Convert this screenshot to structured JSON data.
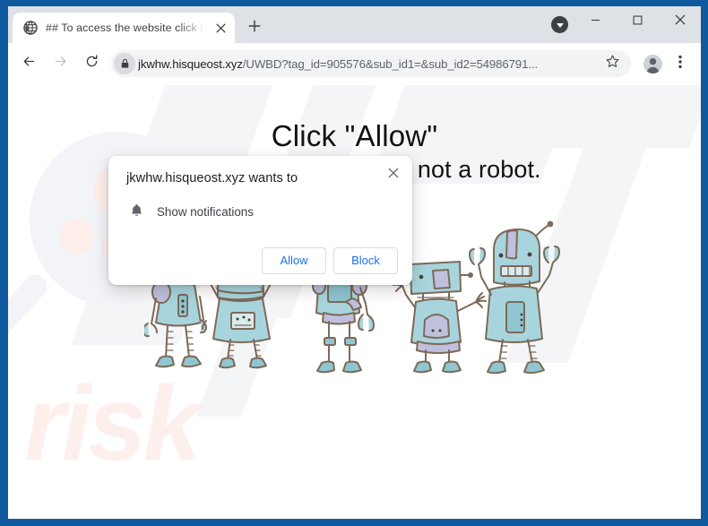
{
  "browser": {
    "tab": {
      "favicon": "globe-icon",
      "title": "## To access the website click th",
      "close_icon": "close-icon"
    },
    "new_tab_icon": "plus-icon",
    "tab_list_dropdown_icon": "chevron-down-icon",
    "window_controls": {
      "minimize": "minimize-icon",
      "maximize": "maximize-icon",
      "close": "close-icon"
    },
    "toolbar": {
      "back_icon": "back-arrow-icon",
      "forward_icon": "forward-arrow-icon",
      "reload_icon": "reload-icon",
      "lock_icon": "lock-icon",
      "url_host": "jkwhw.hisqueost.xyz",
      "url_path": "/UWBD?tag_id=905576&sub_id1=&sub_id2=54986791...",
      "url_full": "jkwhw.hisqueost.xyz/UWBD?tag_id=905576&sub_id1=&sub_id2=54986791...",
      "bookmark_icon": "star-icon",
      "profile_icon": "person-avatar-icon",
      "menu_icon": "three-dots-menu-icon"
    }
  },
  "dialog": {
    "title": "jkwhw.hisqueost.xyz wants to",
    "permission_icon": "bell-icon",
    "permission_label": "Show notifications",
    "close_icon": "close-icon",
    "allow_label": "Allow",
    "block_label": "Block"
  },
  "page": {
    "headline_line1": "Click \"Allow\"",
    "headline_line2": "to confirm that you are not a robot.",
    "illustration": "five-cartoon-robots",
    "watermark_text": "risk",
    "watermark_icon": "magnifying-glass-watermark"
  },
  "colors": {
    "window_frame": "#0f5a9e",
    "tab_strip": "#dee1e6",
    "omnibox": "#f1f3f4",
    "link_blue": "#1a73e8",
    "text_primary": "#202124",
    "text_secondary": "#5f6368",
    "robot_body": "#a8d5dd",
    "robot_outline": "#7d6a58",
    "robot_accent": "#c0c0de",
    "watermark_pink": "#fdf0ec"
  }
}
